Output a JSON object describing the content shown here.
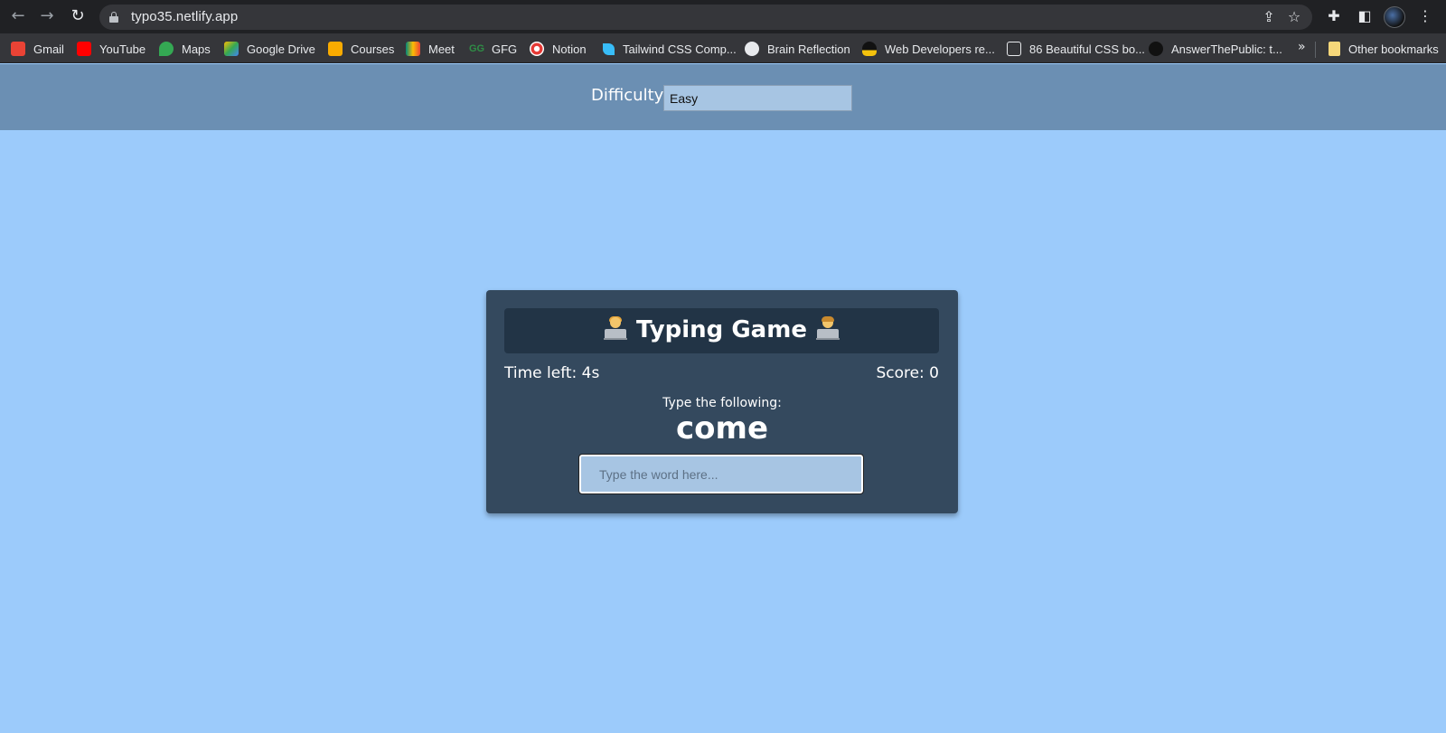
{
  "browser": {
    "url": "typo35.netlify.app",
    "bookmarks": [
      {
        "label": "Gmail",
        "color": "#ea4335"
      },
      {
        "label": "YouTube",
        "color": "#ff0000"
      },
      {
        "label": "Maps",
        "color": "#34a853"
      },
      {
        "label": "Google Drive",
        "color": "#fbbc04"
      },
      {
        "label": "Courses",
        "color": "#f9ab00"
      },
      {
        "label": "Meet",
        "color": "#00897b"
      },
      {
        "label": "GFG",
        "color": "#2f8d46"
      },
      {
        "label": "Notion",
        "color": "#e53935"
      },
      {
        "label": "Tailwind CSS Comp...",
        "color": "#38bdf8"
      },
      {
        "label": "Brain Reflection",
        "color": "#e8eaed"
      },
      {
        "label": "Web Developers re...",
        "color": "#f4c20d"
      },
      {
        "label": "86 Beautiful CSS bo...",
        "color": "#ffffff"
      },
      {
        "label": "AnswerThePublic: t...",
        "color": "#111111"
      }
    ],
    "other_bookmarks": "Other bookmarks"
  },
  "settings": {
    "difficulty_label": "Difficulty",
    "difficulty_value": "Easy"
  },
  "game": {
    "title": "Typing Game",
    "time_left": "Time left: 4s",
    "score": "Score: 0",
    "instruction": "Type the following:",
    "word": "come",
    "input_placeholder": "Type the word here..."
  },
  "colors": {
    "page_background": "#9ccbfb",
    "settings_bar": "#6b8fb3",
    "card": "#34495e",
    "title_box": "#223446",
    "input_background": "#a7c5e3"
  }
}
